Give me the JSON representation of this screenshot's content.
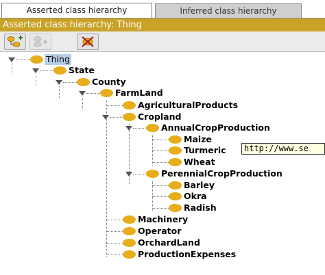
{
  "tabs": [
    {
      "label": "Asserted class hierarchy",
      "active": true
    },
    {
      "label": "Inferred class hierarchy",
      "active": false
    }
  ],
  "panel_title": "Asserted class hierarchy: Thing",
  "toolbar": {
    "add_subclass_icon": "add-subclass-icon",
    "add_sibling_icon": "add-sibling-icon",
    "delete_class_icon": "delete-class-icon"
  },
  "tree": {
    "thing": "Thing",
    "state": "State",
    "county": "County",
    "farmland": "FarmLand",
    "agricultural_products": "AgriculturalProducts",
    "cropland": "Cropland",
    "annual_crop_production": "AnnualCropProduction",
    "maize": "Maize",
    "turmeric": "Turmeric",
    "wheat": "Wheat",
    "perennial_crop_production": "PerennialCropProduction",
    "barley": "Barley",
    "okra": "Okra",
    "radish": "Radish",
    "machinery": "Machinery",
    "operator": "Operator",
    "orchardland": "OrchardLand",
    "production_expenses": "ProductionExpenses"
  },
  "tooltip": "http://www.se",
  "colors": {
    "accent": "#c9a227",
    "class_bullet": "#e8ad1a",
    "selection": "#b8cfe8"
  }
}
